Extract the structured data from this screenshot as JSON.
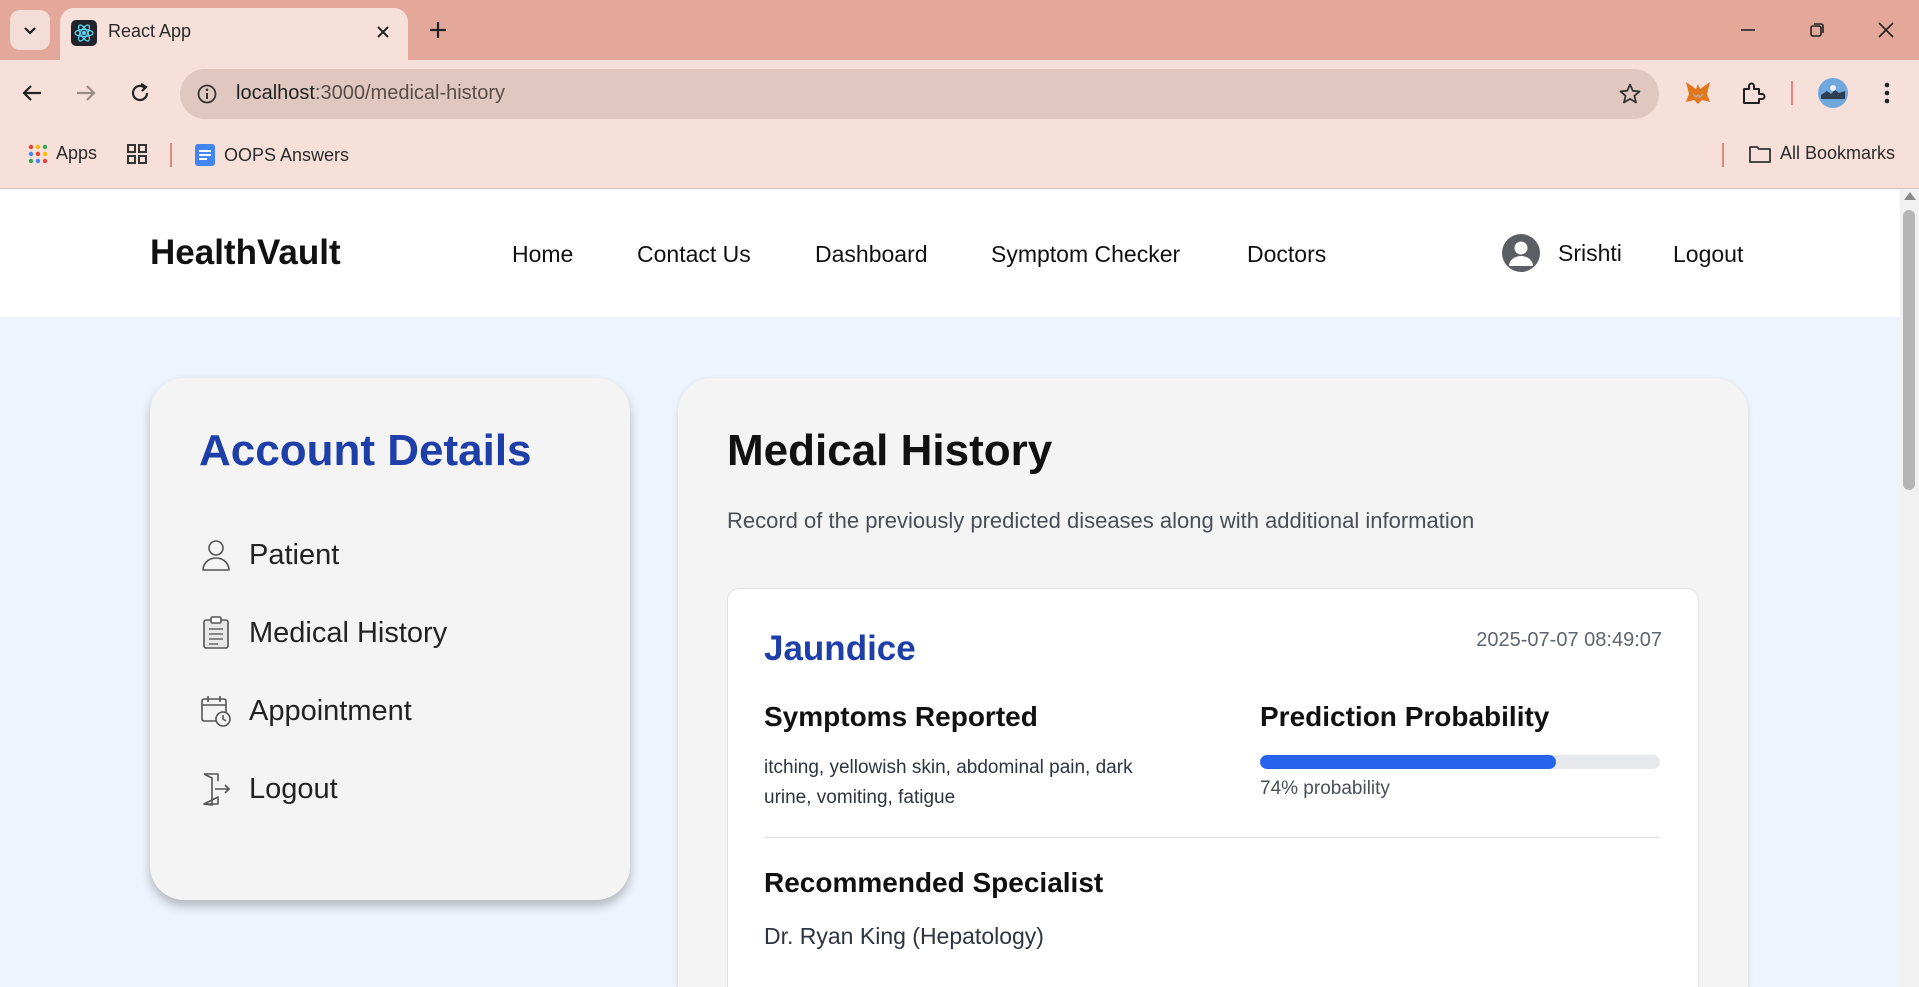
{
  "browser": {
    "tab_title": "React App",
    "url_host": "localhost",
    "url_path": ":3000/medical-history",
    "bookmarks": [
      {
        "label": "Apps"
      },
      {
        "label": "OOPS Answers"
      }
    ],
    "all_bookmarks_label": "All Bookmarks"
  },
  "nav": {
    "brand": "HealthVault",
    "links": [
      "Home",
      "Contact Us",
      "Dashboard",
      "Symptom Checker",
      "Doctors"
    ],
    "username": "Srishti",
    "logout": "Logout"
  },
  "sidebar": {
    "title": "Account Details",
    "items": [
      {
        "label": "Patient",
        "icon": "user-icon"
      },
      {
        "label": "Medical History",
        "icon": "clipboard-icon"
      },
      {
        "label": "Appointment",
        "icon": "calendar-clock-icon"
      },
      {
        "label": "Logout",
        "icon": "logout-door-icon"
      }
    ]
  },
  "main": {
    "title": "Medical History",
    "subtitle": "Record of the previously predicted diseases along with additional information",
    "records": [
      {
        "disease": "Jaundice",
        "date": "2025-07-07 08:49:07",
        "symptoms_heading": "Symptoms Reported",
        "symptoms": "itching, yellowish skin, abdominal pain, dark urine, vomiting, fatigue",
        "probability_heading": "Prediction Probability",
        "probability": 74,
        "probability_text": "74% probability",
        "specialist_heading": "Recommended Specialist",
        "specialist": "Dr. Ryan King (Hepatology)"
      }
    ]
  },
  "colors": {
    "accent": "#1e3fa8",
    "progress": "#2563eb",
    "page_bg": "#eef4fd",
    "tabbar": "#e3a899"
  }
}
